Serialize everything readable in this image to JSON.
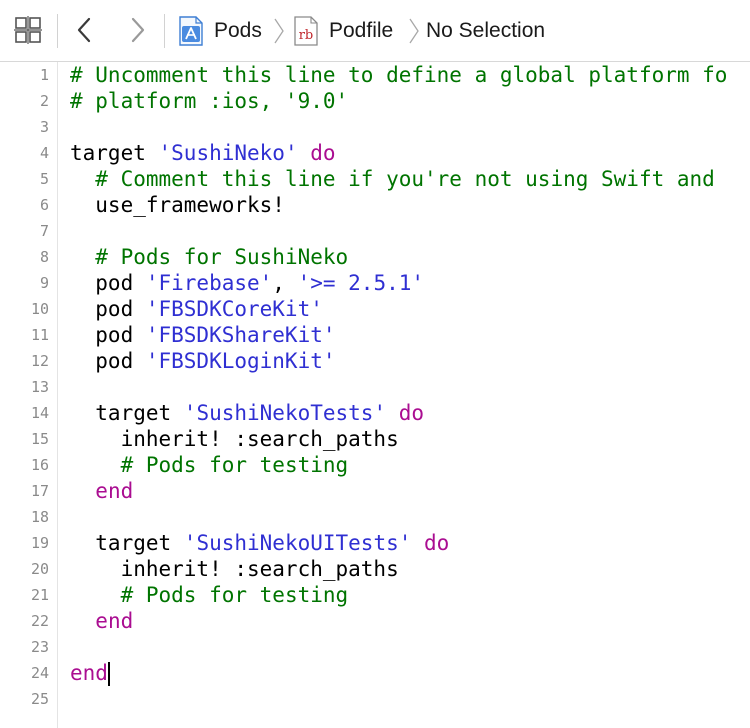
{
  "toolbar": {
    "grid_icon": "related-items-grid-icon",
    "back_icon": "chevron-left-icon",
    "forward_icon": "chevron-right-icon",
    "breadcrumb": [
      {
        "label": "Pods",
        "icon": "xcode-project-icon"
      },
      {
        "label": "Podfile",
        "icon": "ruby-file-icon",
        "icon_text": "rb"
      },
      {
        "label": "No Selection"
      }
    ]
  },
  "editor": {
    "colors": {
      "comment": "#007400",
      "string": "#2f2fd2",
      "keyword": "#aa0d91",
      "plain": "#000000",
      "line_number": "#8a8a8a"
    },
    "cursor_line": 24,
    "lines": [
      {
        "n": "1",
        "tokens": [
          {
            "t": "comment",
            "v": "# Uncomment this line to define a global platform fo"
          }
        ]
      },
      {
        "n": "2",
        "tokens": [
          {
            "t": "comment",
            "v": "# platform :ios, '9.0'"
          }
        ]
      },
      {
        "n": "3",
        "tokens": []
      },
      {
        "n": "4",
        "tokens": [
          {
            "t": "plain",
            "v": "target "
          },
          {
            "t": "string",
            "v": "'SushiNeko'"
          },
          {
            "t": "plain",
            "v": " "
          },
          {
            "t": "keyword",
            "v": "do"
          }
        ]
      },
      {
        "n": "5",
        "tokens": [
          {
            "t": "plain",
            "v": "  "
          },
          {
            "t": "comment",
            "v": "# Comment this line if you're not using Swift and"
          }
        ]
      },
      {
        "n": "6",
        "tokens": [
          {
            "t": "plain",
            "v": "  use_frameworks!"
          }
        ]
      },
      {
        "n": "7",
        "tokens": []
      },
      {
        "n": "8",
        "tokens": [
          {
            "t": "plain",
            "v": "  "
          },
          {
            "t": "comment",
            "v": "# Pods for SushiNeko"
          }
        ]
      },
      {
        "n": "9",
        "tokens": [
          {
            "t": "plain",
            "v": "  pod "
          },
          {
            "t": "string",
            "v": "'Firebase'"
          },
          {
            "t": "plain",
            "v": ", "
          },
          {
            "t": "string",
            "v": "'>= 2.5.1'"
          }
        ]
      },
      {
        "n": "10",
        "tokens": [
          {
            "t": "plain",
            "v": "  pod "
          },
          {
            "t": "string",
            "v": "'FBSDKCoreKit'"
          }
        ]
      },
      {
        "n": "11",
        "tokens": [
          {
            "t": "plain",
            "v": "  pod "
          },
          {
            "t": "string",
            "v": "'FBSDKShareKit'"
          }
        ]
      },
      {
        "n": "12",
        "tokens": [
          {
            "t": "plain",
            "v": "  pod "
          },
          {
            "t": "string",
            "v": "'FBSDKLoginKit'"
          }
        ]
      },
      {
        "n": "13",
        "tokens": []
      },
      {
        "n": "14",
        "tokens": [
          {
            "t": "plain",
            "v": "  target "
          },
          {
            "t": "string",
            "v": "'SushiNekoTests'"
          },
          {
            "t": "plain",
            "v": " "
          },
          {
            "t": "keyword",
            "v": "do"
          }
        ]
      },
      {
        "n": "15",
        "tokens": [
          {
            "t": "plain",
            "v": "    inherit! :search_paths"
          }
        ]
      },
      {
        "n": "16",
        "tokens": [
          {
            "t": "plain",
            "v": "    "
          },
          {
            "t": "comment",
            "v": "# Pods for testing"
          }
        ]
      },
      {
        "n": "17",
        "tokens": [
          {
            "t": "plain",
            "v": "  "
          },
          {
            "t": "keyword",
            "v": "end"
          }
        ]
      },
      {
        "n": "18",
        "tokens": []
      },
      {
        "n": "19",
        "tokens": [
          {
            "t": "plain",
            "v": "  target "
          },
          {
            "t": "string",
            "v": "'SushiNekoUITests'"
          },
          {
            "t": "plain",
            "v": " "
          },
          {
            "t": "keyword",
            "v": "do"
          }
        ]
      },
      {
        "n": "20",
        "tokens": [
          {
            "t": "plain",
            "v": "    inherit! :search_paths"
          }
        ]
      },
      {
        "n": "21",
        "tokens": [
          {
            "t": "plain",
            "v": "    "
          },
          {
            "t": "comment",
            "v": "# Pods for testing"
          }
        ]
      },
      {
        "n": "22",
        "tokens": [
          {
            "t": "plain",
            "v": "  "
          },
          {
            "t": "keyword",
            "v": "end"
          }
        ]
      },
      {
        "n": "23",
        "tokens": []
      },
      {
        "n": "24",
        "tokens": [
          {
            "t": "keyword",
            "v": "end"
          }
        ]
      },
      {
        "n": "25",
        "tokens": []
      }
    ]
  }
}
